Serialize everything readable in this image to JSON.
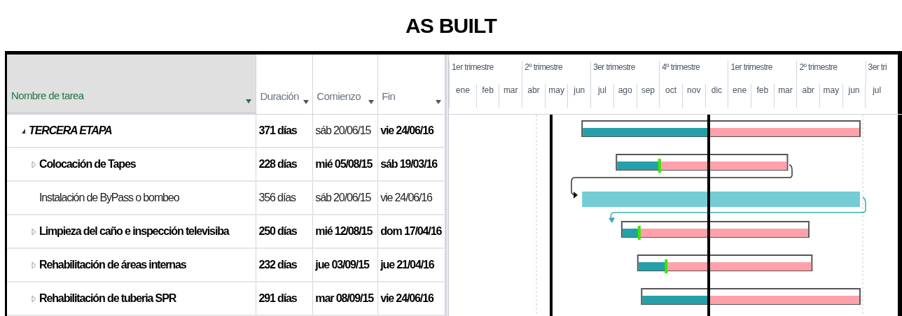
{
  "title": "AS BUILT",
  "table": {
    "columns": [
      "Nombre de tarea",
      "Duración",
      "Comienzo",
      "Fin"
    ],
    "rows": [
      {
        "kind": "summary",
        "name": "TERCERA ETAPA",
        "duration": "371 días",
        "start": "sáb 20/06/15",
        "end": "vie 24/06/16",
        "level": 0.46,
        "marker": false
      },
      {
        "kind": "group",
        "name": "Colocación de Tapes",
        "duration": "228 días",
        "start": "mié 05/08/15",
        "end": "sáb 19/03/16",
        "level": 0.25,
        "marker": true
      },
      {
        "kind": "task",
        "name": "Instalación de ByPass o bombeo",
        "duration": "356 días",
        "start": "sáb 20/06/15",
        "end": "vie 24/06/16",
        "level": 1,
        "marker": false
      },
      {
        "kind": "group",
        "name": "Limpieza del caño e inspección televisiba",
        "duration": "250 días",
        "start": "mié 12/08/15",
        "end": "dom 17/04/16",
        "level": 0.09,
        "marker": true
      },
      {
        "kind": "group",
        "name": "Rehabilitación de áreas internas",
        "duration": "232 días",
        "start": "jue 03/09/15",
        "end": "jue 21/04/16",
        "level": 0.16,
        "marker": true
      },
      {
        "kind": "group",
        "name": "Rehabilitación de tuberia SPR",
        "duration": "291 días",
        "start": "mar 08/09/15",
        "end": "vie 24/06/16",
        "level": 0.31,
        "marker": false
      }
    ]
  },
  "timescale": {
    "quarters": [
      "1er trimestre",
      "2º trimestre",
      "3er trimestre",
      "4º trimestre",
      "1er trimestre",
      "2º trimestre",
      "3er tri"
    ],
    "months": [
      "ene",
      "feb",
      "mar",
      "abr",
      "may",
      "jun",
      "jul",
      "ago",
      "sep",
      "oct",
      "nov",
      "dic",
      "ene",
      "feb",
      "mar",
      "abr",
      "may",
      "jun",
      "jul"
    ]
  }
}
